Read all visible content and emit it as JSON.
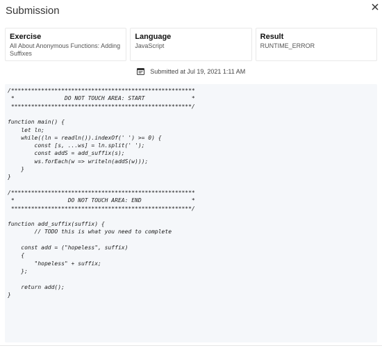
{
  "dialog": {
    "title": "Submission",
    "close_icon": "close-icon"
  },
  "cards": [
    {
      "label": "Exercise",
      "value": "All About Anonymous Functions: Adding Suffixes"
    },
    {
      "label": "Language",
      "value": "JavaScript"
    },
    {
      "label": "Result",
      "value": "RUNTIME_ERROR"
    }
  ],
  "submitted": {
    "icon": "calendar-icon",
    "text": "Submitted at Jul 19, 2021 1:11 AM"
  },
  "code": {
    "lines": [
      "/*******************************************************",
      " *               DO NOT TOUCH AREA: START              *",
      " ******************************************************/",
      "",
      "function main() {",
      "    let ln;",
      "    while((ln = readln()).indexOf(' ') >= 0) {",
      "        const [s, ...ws] = ln.split(' ');",
      "        const addS = add_suffix(s);",
      "        ws.forEach(w => writeln(addS(w)));",
      "    }",
      "}",
      "",
      "/*******************************************************",
      " *                DO NOT TOUCH AREA: END               *",
      " ******************************************************/",
      "",
      "function add_suffix(suffix) {",
      "        // TODO this is what you need to complete",
      "",
      "    const add = (\"hopeless\", suffix)",
      "    {",
      "        \"hopeless\" + suffix;",
      "    };",
      "",
      "    return add();",
      "}"
    ]
  }
}
